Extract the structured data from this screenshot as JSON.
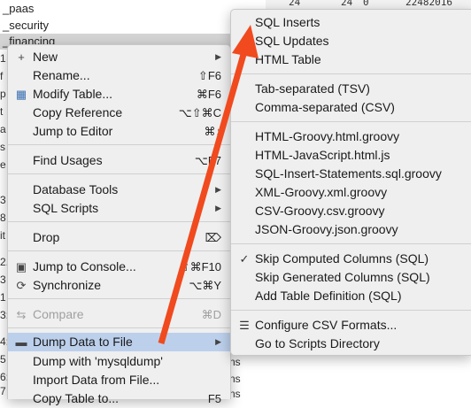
{
  "tree": {
    "items": [
      {
        "label": "_paas"
      },
      {
        "label": "_security"
      },
      {
        "label": "_financing"
      }
    ],
    "gutter_chars": [
      "1",
      "f",
      "p",
      "t",
      "a",
      "s",
      "e",
      "",
      "3",
      "8",
      "it",
      "",
      "2.",
      "3",
      "1",
      "3:",
      "",
      "4:",
      "",
      "5",
      "6:",
      "",
      "7",
      "8"
    ],
    "grid_values": [
      "24",
      "24",
      "0",
      "22482016"
    ],
    "trailing": [
      "ns",
      "ns",
      "ns"
    ]
  },
  "main_menu": {
    "items": [
      {
        "icon": "plus-icon",
        "glyph": "+",
        "label": "New",
        "shortcut": "",
        "submenu": true
      },
      {
        "icon": "",
        "glyph": "",
        "label": "Rename...",
        "shortcut": "⇧F6",
        "submenu": false
      },
      {
        "icon": "table-icon",
        "glyph": "▦",
        "label": "Modify Table...",
        "shortcut": "⌘F6",
        "submenu": false
      },
      {
        "icon": "",
        "glyph": "",
        "label": "Copy Reference",
        "shortcut": "⌥⇧⌘C",
        "submenu": false
      },
      {
        "icon": "",
        "glyph": "",
        "label": "Jump to Editor",
        "shortcut": "⌘↓",
        "submenu": false
      },
      {
        "icon": "",
        "glyph": "",
        "label": "Find Usages",
        "shortcut": "⌥F7",
        "submenu": false
      },
      {
        "icon": "",
        "glyph": "",
        "label": "Database Tools",
        "shortcut": "",
        "submenu": true
      },
      {
        "icon": "",
        "glyph": "",
        "label": "SQL Scripts",
        "shortcut": "",
        "submenu": true
      },
      {
        "icon": "",
        "glyph": "",
        "label": "Drop",
        "shortcut": "⌦",
        "submenu": false
      },
      {
        "icon": "console-icon",
        "glyph": "▣",
        "label": "Jump to Console...",
        "shortcut": "⇧⌘F10",
        "submenu": false
      },
      {
        "icon": "sync-icon",
        "glyph": "⟳",
        "label": "Synchronize",
        "shortcut": "⌥⌘Y",
        "submenu": false
      },
      {
        "icon": "compare-icon",
        "glyph": "⇆",
        "label": "Compare",
        "shortcut": "⌘D",
        "submenu": false,
        "disabled": true
      },
      {
        "icon": "save-icon",
        "glyph": "▬",
        "label": "Dump Data to File",
        "shortcut": "",
        "submenu": true,
        "highlighted": true
      },
      {
        "icon": "",
        "glyph": "",
        "label": "Dump with 'mysqldump'",
        "shortcut": "",
        "submenu": false
      },
      {
        "icon": "",
        "glyph": "",
        "label": "Import Data from File...",
        "shortcut": "",
        "submenu": false
      },
      {
        "icon": "",
        "glyph": "",
        "label": "Copy Table to...",
        "shortcut": "F5",
        "submenu": false
      }
    ]
  },
  "dump_submenu": {
    "items": [
      {
        "label": "SQL Inserts",
        "icon": "",
        "glyph": ""
      },
      {
        "label": "SQL Updates",
        "icon": "",
        "glyph": ""
      },
      {
        "label": "HTML Table",
        "icon": "",
        "glyph": ""
      },
      {
        "label": "Tab-separated (TSV)",
        "icon": "",
        "glyph": ""
      },
      {
        "label": "Comma-separated (CSV)",
        "icon": "",
        "glyph": ""
      },
      {
        "label": "HTML-Groovy.html.groovy",
        "icon": "",
        "glyph": ""
      },
      {
        "label": "HTML-JavaScript.html.js",
        "icon": "",
        "glyph": ""
      },
      {
        "label": "SQL-Insert-Statements.sql.groovy",
        "icon": "",
        "glyph": ""
      },
      {
        "label": "XML-Groovy.xml.groovy",
        "icon": "",
        "glyph": ""
      },
      {
        "label": "CSV-Groovy.csv.groovy",
        "icon": "",
        "glyph": ""
      },
      {
        "label": "JSON-Groovy.json.groovy",
        "icon": "",
        "glyph": ""
      },
      {
        "label": "Skip Computed Columns (SQL)",
        "icon": "checkmark-icon",
        "glyph": "✓"
      },
      {
        "label": "Skip Generated Columns (SQL)",
        "icon": "",
        "glyph": ""
      },
      {
        "label": "Add Table Definition (SQL)",
        "icon": "",
        "glyph": ""
      },
      {
        "label": "Configure CSV Formats...",
        "icon": "settings-sliders-icon",
        "glyph": "☰"
      },
      {
        "label": "Go to Scripts Directory",
        "icon": "",
        "glyph": ""
      }
    ]
  },
  "colors": {
    "arrow": "#f04a1e",
    "highlight": "#bcd0ec",
    "menu_bg": "#efefef"
  }
}
